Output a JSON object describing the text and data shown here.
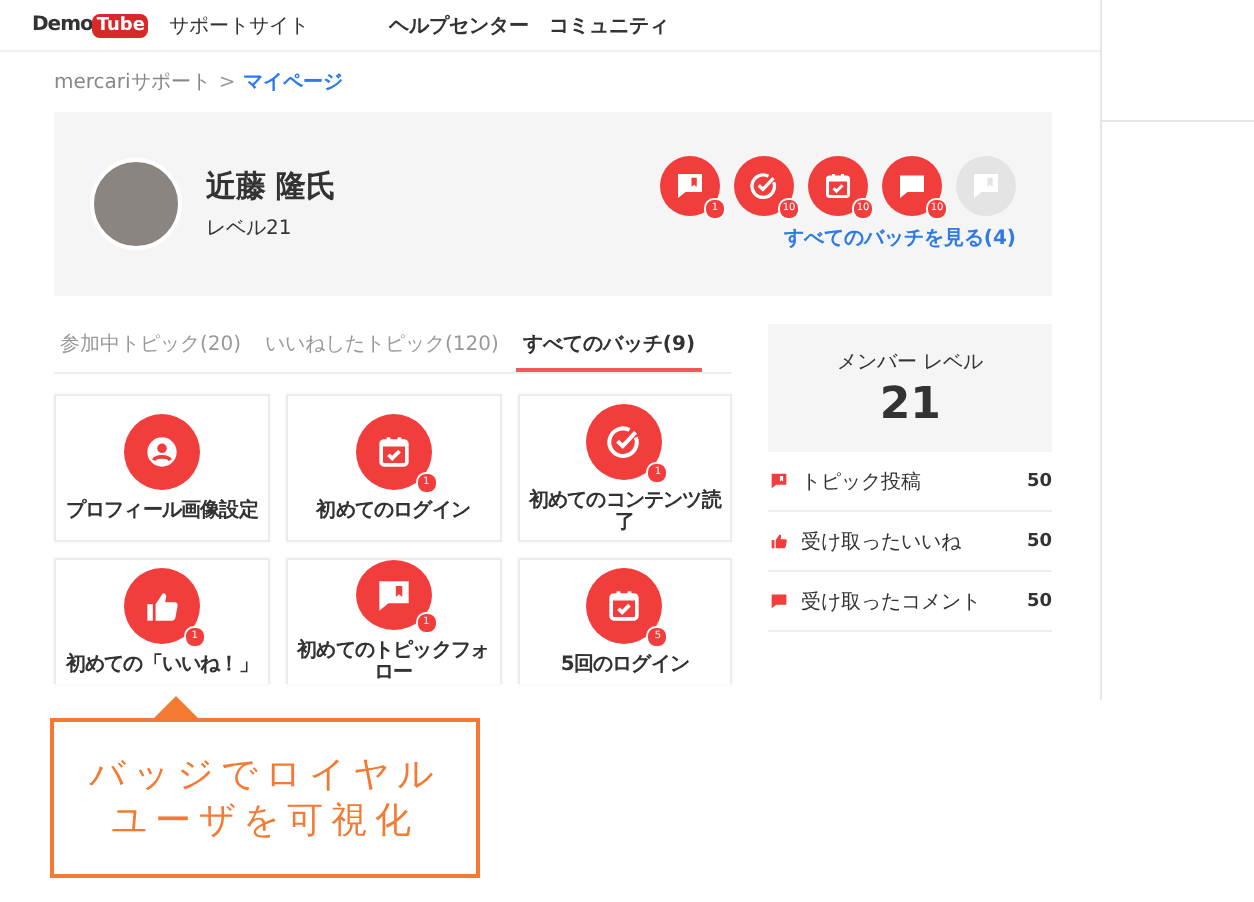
{
  "header": {
    "logo_text": "Demo",
    "logo_badge": "Tube",
    "site_label": "サポートサイト",
    "nav": [
      {
        "label": "ヘルプセンター"
      },
      {
        "label": "コミュニティ"
      }
    ]
  },
  "breadcrumb": {
    "items": [
      {
        "label": "mercariサポート",
        "current": false
      },
      {
        "label": "マイページ",
        "current": true
      }
    ],
    "separator": ">"
  },
  "profile": {
    "name": "近藤 隆氏",
    "level": "レベル21",
    "badges": [
      {
        "kind": "flag",
        "count": "1",
        "earned": true
      },
      {
        "kind": "check",
        "count": "10",
        "earned": true
      },
      {
        "kind": "calendar",
        "count": "10",
        "earned": true
      },
      {
        "kind": "comment",
        "count": "10",
        "earned": true
      },
      {
        "kind": "flag",
        "earned": false
      }
    ],
    "all_badges_link": "すべてのバッチを見る(4)"
  },
  "tabs": [
    {
      "label": "参加中トピック(20)",
      "selected": false
    },
    {
      "label": "いいねしたトピック(120)",
      "selected": false
    },
    {
      "label": "すべてのバッチ(9)",
      "selected": true
    }
  ],
  "badge_cards": [
    {
      "kind": "person",
      "label": "プロフィール画像設定"
    },
    {
      "kind": "calendar",
      "count": "1",
      "label": "初めてのログイン"
    },
    {
      "kind": "check",
      "count": "1",
      "label": "初めてのコンテンツ読了"
    },
    {
      "kind": "thumb",
      "count": "1",
      "label": "初めての「いいね！」"
    },
    {
      "kind": "flag",
      "count": "1",
      "label": "初めてのトピックフォロー"
    },
    {
      "kind": "calendar",
      "count": "5",
      "label": "5回のログイン"
    }
  ],
  "member_level": {
    "label": "メンバー レベル",
    "value": "21"
  },
  "stats": [
    {
      "kind": "flag",
      "label": "トピック投稿",
      "value": "50"
    },
    {
      "kind": "thumb",
      "label": "受け取ったいいね",
      "value": "50"
    },
    {
      "kind": "comment",
      "label": "受け取ったコメント",
      "value": "50"
    }
  ],
  "callout": {
    "lines": [
      "バッジでロイヤル",
      "ユーザを可視化"
    ]
  }
}
